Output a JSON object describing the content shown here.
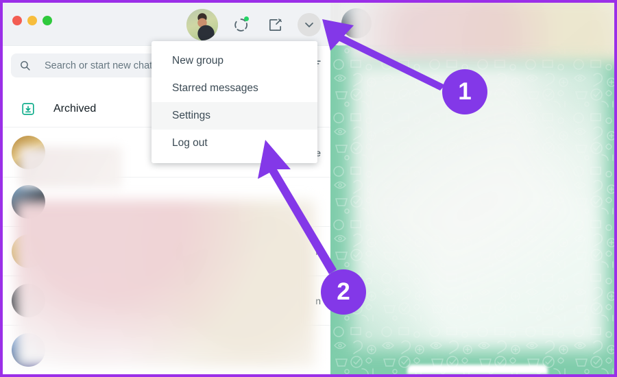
{
  "window": {
    "border_color": "#9b2fe8",
    "traffic_lights": [
      {
        "name": "close",
        "color": "#f35d52"
      },
      {
        "name": "minimize",
        "color": "#f7bd3c"
      },
      {
        "name": "maximize",
        "color": "#2fc93c"
      }
    ]
  },
  "sidebar": {
    "header": {
      "profile_avatar": "user-avatar",
      "status_icon": "status-circle-icon",
      "new_chat_icon": "compose-new-chat-icon",
      "menu_icon": "chevron-down-icon"
    },
    "search": {
      "icon": "search-icon",
      "placeholder": "Search or start new chat",
      "value": "",
      "filter_icon": "filter-icon"
    },
    "archived": {
      "icon": "archive-box-icon",
      "label": "Archived"
    },
    "chats": [
      {
        "avatar": "av1",
        "snippet": "conne"
      },
      {
        "avatar": "av2",
        "snippet": ""
      },
      {
        "avatar": "av3",
        "snippet": "n"
      },
      {
        "avatar": "av4",
        "snippet": "n"
      },
      {
        "avatar": "av5",
        "snippet": ""
      }
    ]
  },
  "menu": {
    "items": [
      {
        "label": "New group",
        "hovered": false
      },
      {
        "label": "Starred messages",
        "hovered": false
      },
      {
        "label": "Settings",
        "hovered": true
      },
      {
        "label": "Log out",
        "hovered": false
      }
    ]
  },
  "chat_panel": {
    "background_color": "#7fcdab",
    "pattern": "whatsapp-doodle-pattern",
    "header_avatar": "contact-avatar",
    "message_input": "message-input-bar"
  },
  "annotations": {
    "accent_color": "#8338e8",
    "steps": [
      {
        "number": "1",
        "target": "chevron-down-icon"
      },
      {
        "number": "2",
        "target": "menu-item-settings"
      }
    ]
  }
}
